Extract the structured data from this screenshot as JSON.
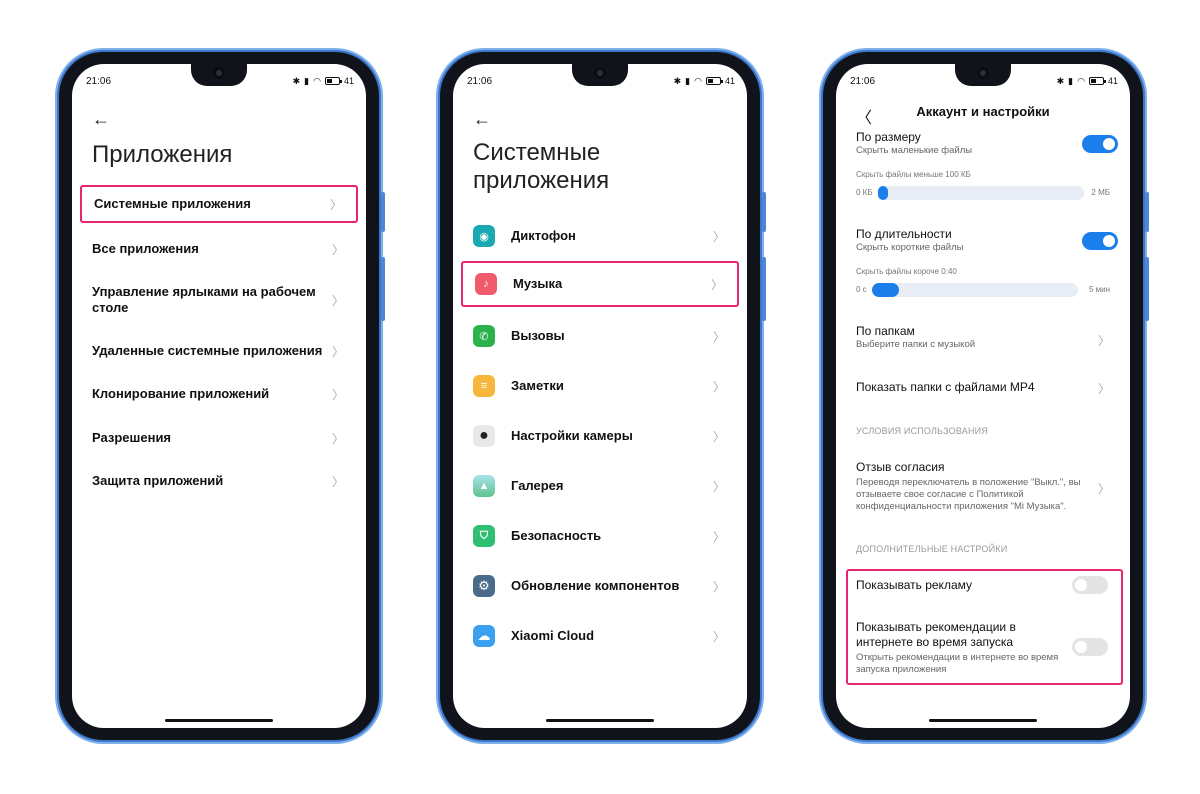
{
  "status": {
    "time": "21:06",
    "battery": "41"
  },
  "phone1": {
    "title": "Приложения",
    "items": [
      {
        "label": "Системные приложения"
      },
      {
        "label": "Все приложения"
      },
      {
        "label": "Управление ярлыками на рабочем столе"
      },
      {
        "label": "Удаленные системные приложения"
      },
      {
        "label": "Клонирование приложений"
      },
      {
        "label": "Разрешения"
      },
      {
        "label": "Защита приложений"
      }
    ]
  },
  "phone2": {
    "title_line1": "Системные",
    "title_line2": "приложения",
    "items": [
      {
        "label": "Диктофон",
        "icon": "recorder-icon",
        "color": "#1aa9b0"
      },
      {
        "label": "Музыка",
        "icon": "music-icon",
        "color": "#f05a6a"
      },
      {
        "label": "Вызовы",
        "icon": "phone-icon",
        "color": "#2bb24c"
      },
      {
        "label": "Заметки",
        "icon": "notes-icon",
        "color": "#f6b73c"
      },
      {
        "label": "Настройки камеры",
        "icon": "camera-icon",
        "color": "#e9e9e9"
      },
      {
        "label": "Галерея",
        "icon": "gallery-icon",
        "color": "#5fc38f"
      },
      {
        "label": "Безопасность",
        "icon": "security-icon",
        "color": "#2fbf71"
      },
      {
        "label": "Обновление компонентов",
        "icon": "gear-icon",
        "color": "#4a6b8a"
      },
      {
        "label": "Xiaomi Cloud",
        "icon": "cloud-icon",
        "color": "#3aa0f0"
      }
    ]
  },
  "phone3": {
    "header": "Аккаунт и настройки",
    "by_size": {
      "title": "По размеру",
      "subtitle": "Скрыть маленькие файлы",
      "hint": "Скрыть файлы меньше 100 КБ",
      "min": "0 КБ",
      "max": "2 МБ",
      "value_fraction": 0.05
    },
    "by_duration": {
      "title": "По длительности",
      "subtitle": "Скрыть короткие файлы",
      "hint": "Скрыть файлы короче 0:40",
      "min": "0 с",
      "max": "5 мин",
      "value_fraction": 0.13
    },
    "by_folders": {
      "title": "По папкам",
      "subtitle": "Выберите папки с музыкой"
    },
    "mp4": {
      "title": "Показать папки с файлами MP4"
    },
    "section_terms": "УСЛОВИЯ ИСПОЛЬЗОВАНИЯ",
    "consent": {
      "title": "Отзыв согласия",
      "subtitle": "Переводя переключатель в положение \"Выкл.\", вы отзываете свое согласие с Политикой конфиденциальности приложения \"Mi Музыка\"."
    },
    "section_extra": "ДОПОЛНИТЕЛЬНЫЕ НАСТРОЙКИ",
    "ads": {
      "title": "Показывать рекламу"
    },
    "recs": {
      "title": "Показывать рекомендации в интернете во время запуска",
      "subtitle": "Открыть рекомендации в интернете во время запуска приложения"
    }
  }
}
